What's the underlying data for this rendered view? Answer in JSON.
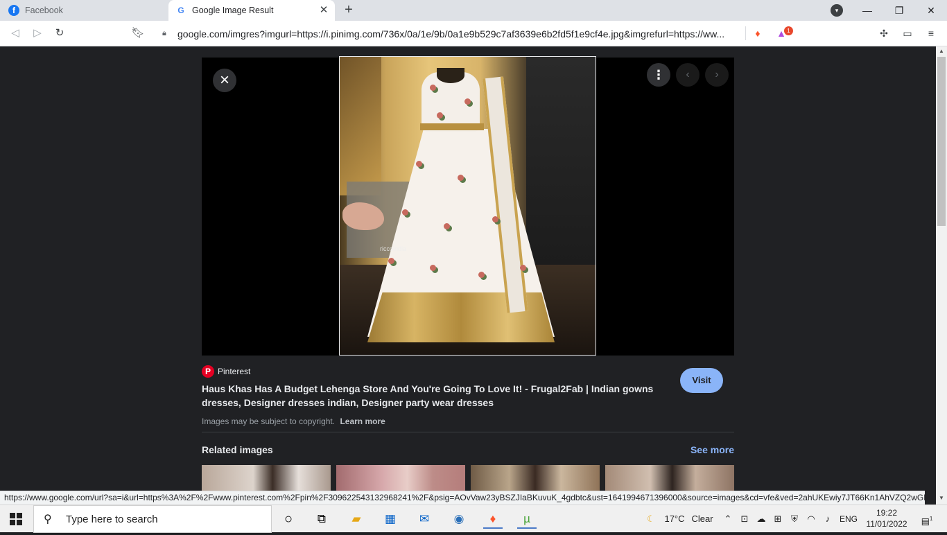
{
  "tabs": [
    {
      "title": "Facebook",
      "icon": "facebook-icon",
      "active": false
    },
    {
      "title": "Google Image Result",
      "icon": "google-icon",
      "active": true
    }
  ],
  "toolbar": {
    "url": "google.com/imgres?imgurl=https://i.pinimg.com/736x/0a/1e/9b/0a1e9b529c7af3639e6b2fd5f1e9cf4e.jpg&imgrefurl=https://ww...",
    "rewards_badge": "1"
  },
  "viewer": {
    "watermark": "riccoindia"
  },
  "result": {
    "source": "Pinterest",
    "title": "Haus Khas Has A Budget Lehenga Store And You're Going To Love It! - Frugal2Fab | Indian gowns dresses, Designer dresses indian, Designer party wear dresses",
    "visit_label": "Visit",
    "copyright": "Images may be subject to copyright.",
    "learn_more": "Learn more"
  },
  "related": {
    "title": "Related images",
    "see_more": "See more"
  },
  "statusbar": {
    "url": "https://www.google.com/url?sa=i&url=https%3A%2F%2Fwww.pinterest.com%2Fpin%2F309622543132968241%2F&psig=AOvVaw23yBSZJIaBKuvuK_4gdbtc&ust=1641994671396000&source=images&cd=vfe&ved=2ahUKEwiy7JT66Kn1AhVZQ2wGH..."
  },
  "taskbar": {
    "search_placeholder": "Type here to search",
    "weather_temp": "17°C",
    "weather_text": "Clear",
    "language": "ENG",
    "time": "19:22",
    "date": "11/01/2022",
    "notification_count": "1"
  },
  "colors": {
    "page_bg": "#202124",
    "accent": "#8ab4f8",
    "pinterest": "#e60023"
  }
}
